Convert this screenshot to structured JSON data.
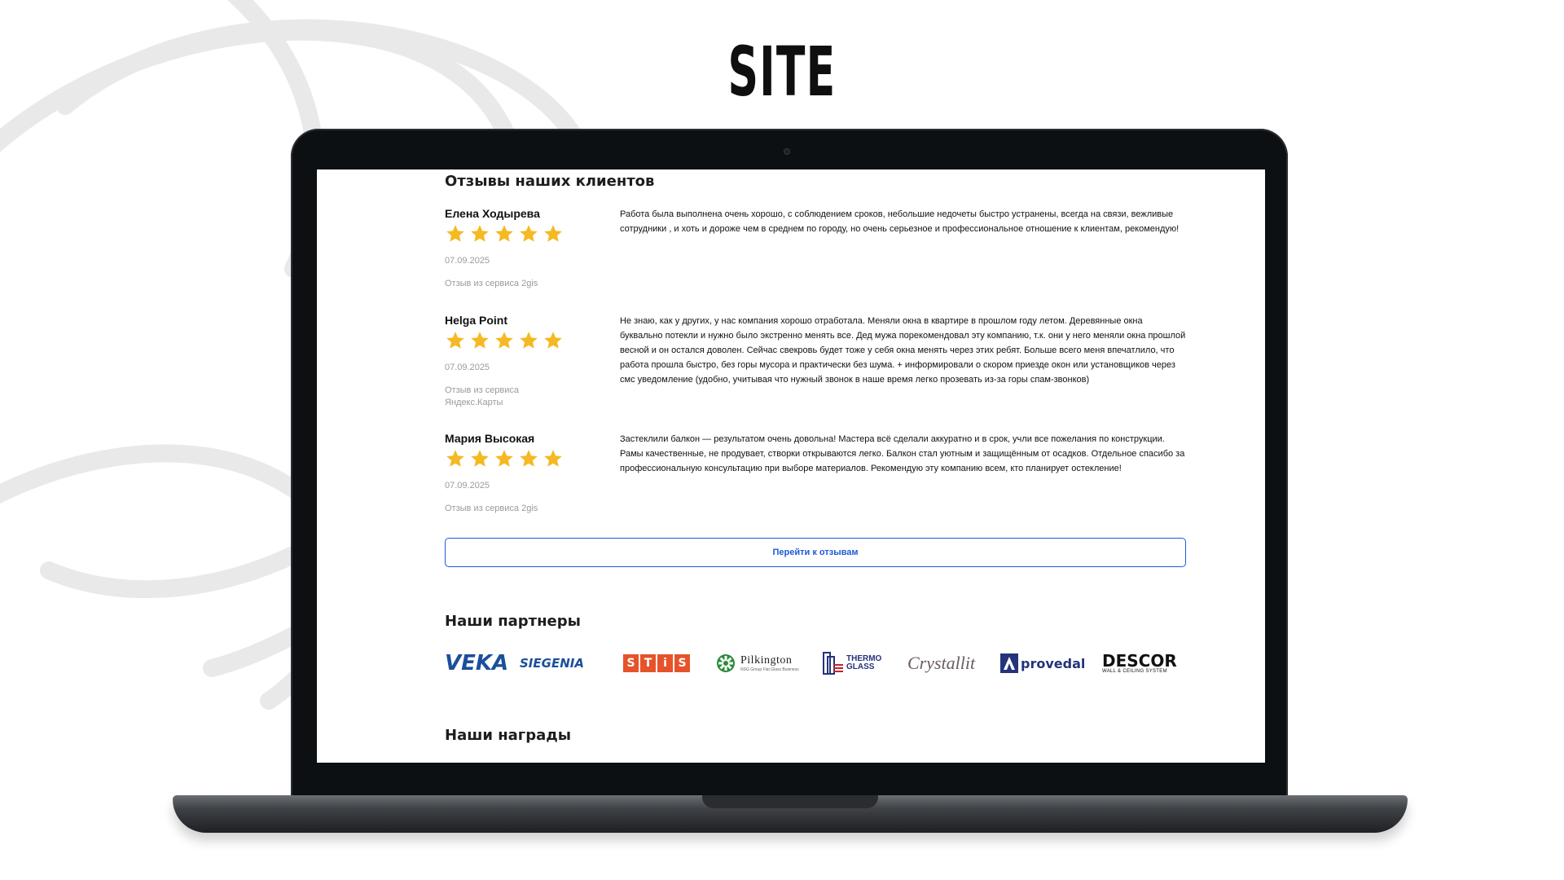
{
  "headline": "SITE",
  "reviews_section": {
    "title": "Отзывы наших клиентов",
    "reviews": [
      {
        "name": "Елена Ходырева",
        "rating": 5,
        "date": "07.09.2025",
        "source": "Отзыв из сервиса 2gis",
        "text": "Работа была выполнена очень хорошо, с соблюдением сроков, небольшие недочеты быстро устранены, всегда на связи, вежливые сотрудники , и хоть и дороже чем в среднем по городу, но очень серьезное и профессиональное отношение к клиентам, рекомендую!"
      },
      {
        "name": "Helga Point",
        "rating": 5,
        "date": "07.09.2025",
        "source": "Отзыв из сервиса Яндекс.Карты",
        "text": "Не знаю, как у других, у нас компания хорошо отработала. Меняли окна в квартире в прошлом году летом. Деревянные окна буквально потекли и нужно было экстренно менять все. Дед мужа порекомендовал эту компанию, т.к. они у него меняли окна прошлой весной и он остался доволен. Сейчас свекровь будет тоже у себя окна менять через этих ребят. Больше всего меня впечатлило, что работа прошла быстро, без горы мусора и практически без шума. + информировали о скором приезде окон или установщиков через смс уведомление (удобно, учитывая что нужный звонок в наше время легко прозевать из-за горы спам-звонков)"
      },
      {
        "name": "Мария Высокая",
        "rating": 5,
        "date": "07.09.2025",
        "source": "Отзыв из сервиса 2gis",
        "text": "Застеклили балкон — результатом очень довольна! Мастера всё сделали аккуратно и в срок, учли все пожелания по конструкции. Рамы качественные, не продувает, створки открываются легко. Балкон стал уютным и защищённым от осадков. Отдельное спасибо за профессиональную консультацию при выборе материалов. Рекомендую эту компанию всем, кто планирует остекление!"
      }
    ],
    "cta_label": "Перейти к отзывам"
  },
  "partners_section": {
    "title": "Наши партнеры",
    "logos": {
      "veka": "VEKA",
      "siegenia": "SIEGENIA",
      "stis_letters": [
        "S",
        "T",
        "i",
        "S"
      ],
      "pilkington": "Pilkington",
      "pilkington_sub": "NSG Group Flat Glass Business",
      "thermo_top": "THERMO",
      "thermo_bottom": "GLASS",
      "crystallit": "Crystallit",
      "provedal": "provedal",
      "descor": "DESCOR",
      "descor_sub": "WALL & CEILING SYSTEM"
    }
  },
  "awards_section": {
    "title": "Наши награды"
  },
  "colors": {
    "star": "#f5b921",
    "accent": "#1e5bd8",
    "laptop_bezel": "#0d1013"
  }
}
